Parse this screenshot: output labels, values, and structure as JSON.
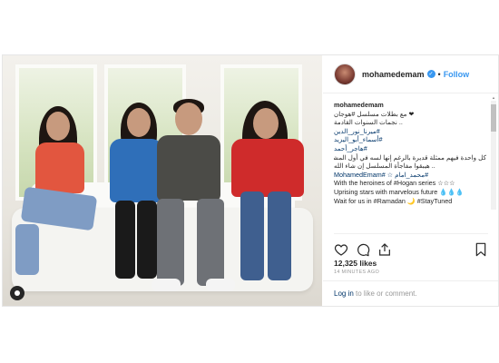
{
  "post": {
    "username": "mohamedemam",
    "follow_label": "Follow",
    "separator": "•",
    "caption": {
      "username": "mohamedemam",
      "lines": [
        "❤︎ مع بطلات مسلسل #هوجان",
        ".. نجمات السنوات القادمة",
        "#ميرنا_نور_الدين",
        "#أسماء_أبو_اليزيد",
        "#هاجر_أحمد",
        "كل واحدة فيهم ممثلة قديرة بالرغم إنها لسه في أول المشوار",
        ".. هيبقوا مفاجأة المسلسل إن شاء الله",
        "#محمد_امام ☆ #MohamedEmam",
        "With the heroines of #Hogan series ☆☆☆",
        "Uprising stars with marvelous future 💧💧💧",
        "Wait for us in #Ramadan 🌙 #StayTuned"
      ]
    },
    "likes": "12,325 likes",
    "time": "14 MINUTES AGO",
    "login_link": "Log in",
    "login_rest": " to like or comment."
  },
  "icons": [
    "heart-icon",
    "comment-icon",
    "share-icon",
    "bookmark-icon",
    "verified-icon",
    "user-tag-icon"
  ],
  "colors": {
    "link": "#3897f0",
    "hashtag": "#003569",
    "text": "#262626",
    "muted": "#999999"
  }
}
